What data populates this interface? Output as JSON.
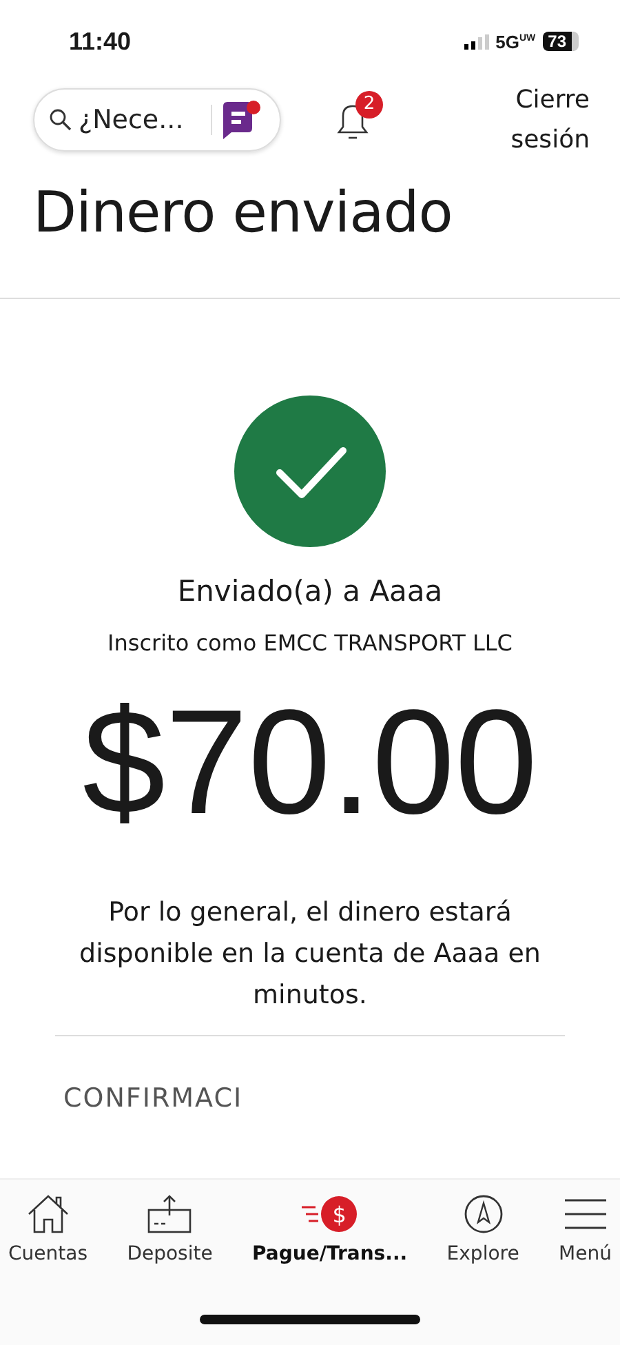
{
  "status_bar": {
    "time": "11:40",
    "network": "5G",
    "network_sub": "UW",
    "battery": "73"
  },
  "header": {
    "search": {
      "placeholder": "¿Nece..."
    },
    "notifications": {
      "count": "2"
    },
    "logout": "Cierre sesión"
  },
  "title": "Dinero enviado",
  "confirmation": {
    "recipient_line": "Enviado(a) a Aaaa",
    "enrolled_line": "Inscrito como EMCC TRANSPORT LLC",
    "amount": "$70.00",
    "note": "Por lo general, el dinero estará disponible en la cuenta de Aaaa en minutos.",
    "section_heading": "CONFIRMACI"
  },
  "nav": [
    {
      "kind": "home",
      "label": "Cuentas",
      "selected": false
    },
    {
      "kind": "deposit",
      "label": "Deposite",
      "selected": false
    },
    {
      "kind": "pay",
      "label": "Pague/Trans...",
      "glyph": "$",
      "selected": true
    },
    {
      "kind": "explore",
      "label": "Explore",
      "selected": false
    },
    {
      "kind": "menu",
      "label": "Menú",
      "selected": false
    }
  ]
}
